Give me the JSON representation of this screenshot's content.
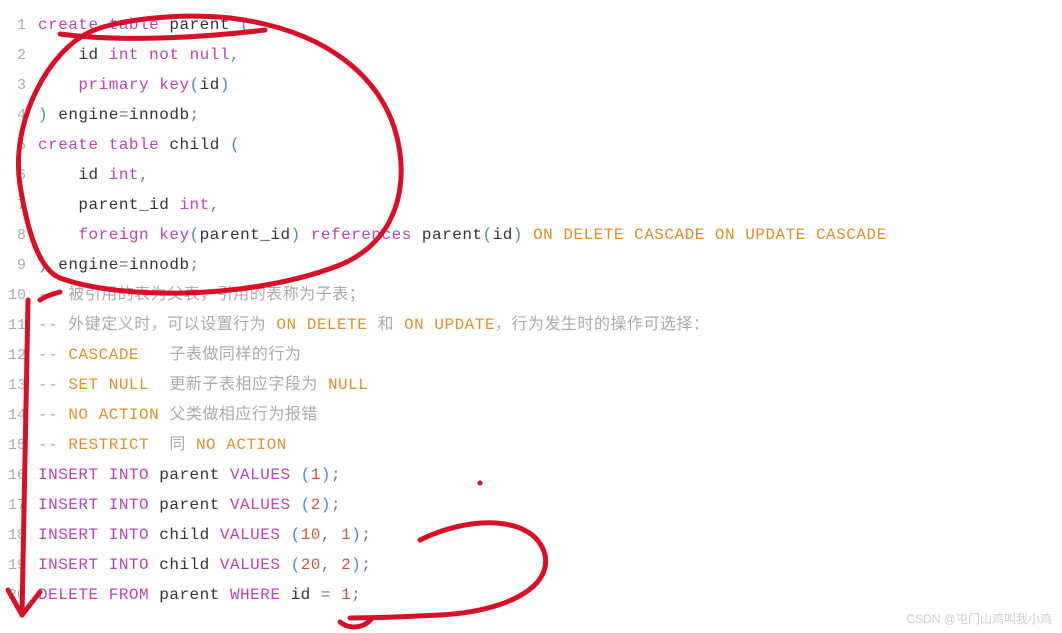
{
  "watermark": "CSDN @屯门山鸡叫我小鸡",
  "lines": [
    {
      "n": "1",
      "tokens": [
        [
          "kw",
          "create"
        ],
        [
          "",
          " "
        ],
        [
          "kw",
          "table"
        ],
        [
          "",
          " "
        ],
        [
          "ident",
          "parent"
        ],
        [
          "",
          " "
        ],
        [
          "paren",
          "("
        ]
      ]
    },
    {
      "n": "2",
      "tokens": [
        [
          "",
          "    "
        ],
        [
          "ident",
          "id"
        ],
        [
          "",
          " "
        ],
        [
          "kw",
          "int"
        ],
        [
          "",
          " "
        ],
        [
          "kw",
          "not"
        ],
        [
          "",
          " "
        ],
        [
          "kw",
          "null"
        ],
        [
          "punct",
          ","
        ]
      ]
    },
    {
      "n": "3",
      "tokens": [
        [
          "",
          "    "
        ],
        [
          "kw",
          "primary"
        ],
        [
          "",
          " "
        ],
        [
          "kw",
          "key"
        ],
        [
          "paren",
          "("
        ],
        [
          "ident",
          "id"
        ],
        [
          "paren",
          ")"
        ]
      ]
    },
    {
      "n": "4",
      "tokens": [
        [
          "paren",
          ")"
        ],
        [
          "",
          " "
        ],
        [
          "ident",
          "engine"
        ],
        [
          "punct",
          "="
        ],
        [
          "ident",
          "innodb"
        ],
        [
          "punct",
          ";"
        ]
      ]
    },
    {
      "n": "5",
      "tokens": [
        [
          "kw",
          "create"
        ],
        [
          "",
          " "
        ],
        [
          "kw",
          "table"
        ],
        [
          "",
          " "
        ],
        [
          "ident",
          "child"
        ],
        [
          "",
          " "
        ],
        [
          "paren",
          "("
        ]
      ]
    },
    {
      "n": "6",
      "tokens": [
        [
          "",
          "    "
        ],
        [
          "ident",
          "id"
        ],
        [
          "",
          " "
        ],
        [
          "kw",
          "int"
        ],
        [
          "punct",
          ","
        ]
      ]
    },
    {
      "n": "7",
      "tokens": [
        [
          "",
          "    "
        ],
        [
          "ident",
          "parent_id"
        ],
        [
          "",
          " "
        ],
        [
          "kw",
          "int"
        ],
        [
          "punct",
          ","
        ]
      ]
    },
    {
      "n": "8",
      "tokens": [
        [
          "",
          "    "
        ],
        [
          "kw",
          "foreign"
        ],
        [
          "",
          " "
        ],
        [
          "kw",
          "key"
        ],
        [
          "paren",
          "("
        ],
        [
          "ident",
          "parent_id"
        ],
        [
          "paren",
          ")"
        ],
        [
          "",
          " "
        ],
        [
          "kw",
          "references"
        ],
        [
          "",
          " "
        ],
        [
          "ident",
          "parent"
        ],
        [
          "paren",
          "("
        ],
        [
          "ident",
          "id"
        ],
        [
          "paren",
          ")"
        ],
        [
          "",
          " "
        ],
        [
          "upper",
          "ON"
        ],
        [
          "",
          " "
        ],
        [
          "upper",
          "DELETE"
        ],
        [
          "",
          " "
        ],
        [
          "upper",
          "CASCADE"
        ],
        [
          "",
          " "
        ],
        [
          "upper",
          "ON"
        ],
        [
          "",
          " "
        ],
        [
          "upper",
          "UPDATE"
        ],
        [
          "",
          " "
        ],
        [
          "upper",
          "CASCADE"
        ]
      ]
    },
    {
      "n": "9",
      "tokens": [
        [
          "paren",
          ")"
        ],
        [
          "",
          " "
        ],
        [
          "ident",
          "engine"
        ],
        [
          "punct",
          "="
        ],
        [
          "ident",
          "innodb"
        ],
        [
          "punct",
          ";"
        ]
      ]
    },
    {
      "n": "10",
      "tokens": [
        [
          "comment",
          "-- 被引用的表为父表，引用的表称为子表；"
        ]
      ]
    },
    {
      "n": "11",
      "tokens": [
        [
          "comment",
          "-- 外键定义时，可以设置行为 "
        ],
        [
          "comment-kw",
          "ON DELETE"
        ],
        [
          "comment",
          " 和 "
        ],
        [
          "comment-kw",
          "ON UPDATE"
        ],
        [
          "comment",
          "，行为发生时的操作可选择："
        ]
      ]
    },
    {
      "n": "12",
      "tokens": [
        [
          "comment",
          "-- "
        ],
        [
          "comment-kw",
          "CASCADE"
        ],
        [
          "comment",
          "   子表做同样的行为"
        ]
      ]
    },
    {
      "n": "13",
      "tokens": [
        [
          "comment",
          "-- "
        ],
        [
          "comment-kw",
          "SET NULL"
        ],
        [
          "comment",
          "  更新子表相应字段为 "
        ],
        [
          "comment-kw",
          "NULL"
        ]
      ]
    },
    {
      "n": "14",
      "tokens": [
        [
          "comment",
          "-- "
        ],
        [
          "comment-kw",
          "NO ACTION"
        ],
        [
          "comment",
          " 父类做相应行为报错"
        ]
      ]
    },
    {
      "n": "15",
      "tokens": [
        [
          "comment",
          "-- "
        ],
        [
          "comment-kw",
          "RESTRICT"
        ],
        [
          "comment",
          "  同 "
        ],
        [
          "comment-kw",
          "NO ACTION"
        ]
      ]
    },
    {
      "n": "16",
      "tokens": [
        [
          "kw",
          "INSERT"
        ],
        [
          "",
          " "
        ],
        [
          "kw",
          "INTO"
        ],
        [
          "",
          " "
        ],
        [
          "ident",
          "parent"
        ],
        [
          "",
          " "
        ],
        [
          "kw",
          "VALUES"
        ],
        [
          "",
          " "
        ],
        [
          "paren",
          "("
        ],
        [
          "num",
          "1"
        ],
        [
          "paren",
          ")"
        ],
        [
          "punct",
          ";"
        ]
      ]
    },
    {
      "n": "17",
      "tokens": [
        [
          "kw",
          "INSERT"
        ],
        [
          "",
          " "
        ],
        [
          "kw",
          "INTO"
        ],
        [
          "",
          " "
        ],
        [
          "ident",
          "parent"
        ],
        [
          "",
          " "
        ],
        [
          "kw",
          "VALUES"
        ],
        [
          "",
          " "
        ],
        [
          "paren",
          "("
        ],
        [
          "num",
          "2"
        ],
        [
          "paren",
          ")"
        ],
        [
          "punct",
          ";"
        ]
      ]
    },
    {
      "n": "18",
      "tokens": [
        [
          "kw",
          "INSERT"
        ],
        [
          "",
          " "
        ],
        [
          "kw",
          "INTO"
        ],
        [
          "",
          " "
        ],
        [
          "ident",
          "child"
        ],
        [
          "",
          " "
        ],
        [
          "kw",
          "VALUES"
        ],
        [
          "",
          " "
        ],
        [
          "paren",
          "("
        ],
        [
          "num",
          "10"
        ],
        [
          "punct",
          ","
        ],
        [
          "",
          " "
        ],
        [
          "num",
          "1"
        ],
        [
          "paren",
          ")"
        ],
        [
          "punct",
          ";"
        ]
      ]
    },
    {
      "n": "19",
      "tokens": [
        [
          "kw",
          "INSERT"
        ],
        [
          "",
          " "
        ],
        [
          "kw",
          "INTO"
        ],
        [
          "",
          " "
        ],
        [
          "ident",
          "child"
        ],
        [
          "",
          " "
        ],
        [
          "kw",
          "VALUES"
        ],
        [
          "",
          " "
        ],
        [
          "paren",
          "("
        ],
        [
          "num",
          "20"
        ],
        [
          "punct",
          ","
        ],
        [
          "",
          " "
        ],
        [
          "num",
          "2"
        ],
        [
          "paren",
          ")"
        ],
        [
          "punct",
          ";"
        ]
      ]
    },
    {
      "n": "20",
      "tokens": [
        [
          "kw",
          "DELETE"
        ],
        [
          "",
          " "
        ],
        [
          "kw",
          "FROM"
        ],
        [
          "",
          " "
        ],
        [
          "ident",
          "parent"
        ],
        [
          "",
          " "
        ],
        [
          "kw",
          "WHERE"
        ],
        [
          "",
          " "
        ],
        [
          "ident",
          "id"
        ],
        [
          "",
          " "
        ],
        [
          "punct",
          "="
        ],
        [
          "",
          " "
        ],
        [
          "num",
          "1"
        ],
        [
          "punct",
          ";"
        ]
      ]
    }
  ]
}
